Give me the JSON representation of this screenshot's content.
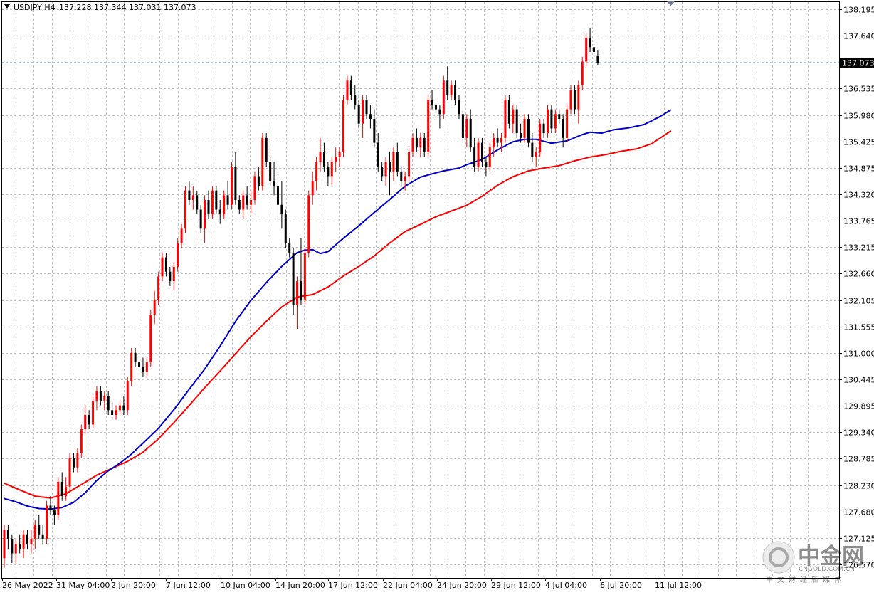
{
  "header": {
    "symbol_label": "USDJPY,H4",
    "ohlc_text": "137.228 137.344 137.031 137.073"
  },
  "colors": {
    "bull_candle": "#ff0000",
    "bear_candle": "#000000",
    "grid": "#c0c0c0",
    "ma_fast": "#0000cd",
    "ma_slow": "#ff0000",
    "price_tag_bg": "#000000",
    "price_line": "#a9b5c8"
  },
  "watermark": {
    "logo_text": "中金网",
    "domain_text": "CNGOLD.COM.CN",
    "tagline": "中文财经新媒体"
  },
  "chart_data": {
    "type": "candlestick",
    "symbol": "USDJPY",
    "timeframe": "H4",
    "current_price_label": "137.073",
    "y_ticks": [
      "138.195",
      "137.640",
      "137.085",
      "136.535",
      "135.980",
      "135.425",
      "134.875",
      "134.320",
      "133.765",
      "133.215",
      "132.660",
      "132.105",
      "131.555",
      "131.000",
      "130.445",
      "129.895",
      "129.340",
      "128.785",
      "128.230",
      "127.680",
      "127.125",
      "126.570"
    ],
    "ylim": [
      126.4,
      138.3
    ],
    "x_ticks": [
      "26 May 2022",
      "31 May 04:00",
      "2 Jun 20:00",
      "7 Jun 12:00",
      "10 Jun 04:00",
      "14 Jun 20:00",
      "17 Jun 12:00",
      "22 Jun 04:00",
      "24 Jun 20:00",
      "29 Jun 12:00",
      "4 Jul 04:00",
      "6 Jul 20:00",
      "11 Jul 12:00"
    ],
    "grid": true,
    "legend": "none",
    "ohlc": [
      [
        126.7,
        127.4,
        126.5,
        127.3
      ],
      [
        127.3,
        127.4,
        126.9,
        127.1
      ],
      [
        127.1,
        127.2,
        126.6,
        126.8
      ],
      [
        126.8,
        127.1,
        126.6,
        127.0
      ],
      [
        127.0,
        127.2,
        126.8,
        126.9
      ],
      [
        126.9,
        127.3,
        126.7,
        127.2
      ],
      [
        127.2,
        127.3,
        126.9,
        127.0
      ],
      [
        127.0,
        127.3,
        126.8,
        127.1
      ],
      [
        127.1,
        127.5,
        126.9,
        127.4
      ],
      [
        127.4,
        127.6,
        127.1,
        127.2
      ],
      [
        127.2,
        127.4,
        127.0,
        127.1
      ],
      [
        127.1,
        127.9,
        127.0,
        127.8
      ],
      [
        127.8,
        128.0,
        127.6,
        127.7
      ],
      [
        127.7,
        127.8,
        127.4,
        127.6
      ],
      [
        127.6,
        128.4,
        127.5,
        128.3
      ],
      [
        128.3,
        128.5,
        127.9,
        128.0
      ],
      [
        128.0,
        128.4,
        127.9,
        128.2
      ],
      [
        128.2,
        128.9,
        128.1,
        128.8
      ],
      [
        128.8,
        128.9,
        128.5,
        128.6
      ],
      [
        128.6,
        129.0,
        128.5,
        128.9
      ],
      [
        128.9,
        129.5,
        128.8,
        129.4
      ],
      [
        129.4,
        129.9,
        129.3,
        129.7
      ],
      [
        129.7,
        129.8,
        129.4,
        129.5
      ],
      [
        129.5,
        130.1,
        129.4,
        130.0
      ],
      [
        130.0,
        130.3,
        129.8,
        130.2
      ],
      [
        130.2,
        130.3,
        129.9,
        130.0
      ],
      [
        130.0,
        130.2,
        129.8,
        130.1
      ],
      [
        130.1,
        130.2,
        129.7,
        129.8
      ],
      [
        129.8,
        130.0,
        129.6,
        129.7
      ],
      [
        129.7,
        129.9,
        129.6,
        129.8
      ],
      [
        129.8,
        130.0,
        129.7,
        129.9
      ],
      [
        129.9,
        130.1,
        129.7,
        129.8
      ],
      [
        129.8,
        130.5,
        129.7,
        130.4
      ],
      [
        130.4,
        131.1,
        130.3,
        131.0
      ],
      [
        131.0,
        131.1,
        130.7,
        130.8
      ],
      [
        130.8,
        130.9,
        130.6,
        130.7
      ],
      [
        130.7,
        130.9,
        130.5,
        130.6
      ],
      [
        130.6,
        130.9,
        130.5,
        130.8
      ],
      [
        130.8,
        131.9,
        130.7,
        131.8
      ],
      [
        131.8,
        132.3,
        131.6,
        132.1
      ],
      [
        132.1,
        132.7,
        132.0,
        132.6
      ],
      [
        132.6,
        133.1,
        132.5,
        133.0
      ],
      [
        133.0,
        133.1,
        132.6,
        132.7
      ],
      [
        132.7,
        132.8,
        132.4,
        132.5
      ],
      [
        132.5,
        132.9,
        132.3,
        132.8
      ],
      [
        132.8,
        133.4,
        132.7,
        133.3
      ],
      [
        133.3,
        133.7,
        133.2,
        133.6
      ],
      [
        133.6,
        134.5,
        133.5,
        134.4
      ],
      [
        134.4,
        134.6,
        134.1,
        134.2
      ],
      [
        134.2,
        134.5,
        134.0,
        134.3
      ],
      [
        134.3,
        134.4,
        133.9,
        134.0
      ],
      [
        134.0,
        134.1,
        133.5,
        133.6
      ],
      [
        133.6,
        134.3,
        133.3,
        134.2
      ],
      [
        134.2,
        134.4,
        133.8,
        133.9
      ],
      [
        133.9,
        134.5,
        133.8,
        134.4
      ],
      [
        134.4,
        134.5,
        133.9,
        134.0
      ],
      [
        134.0,
        134.2,
        133.7,
        133.9
      ],
      [
        133.9,
        134.4,
        133.8,
        134.3
      ],
      [
        134.3,
        134.6,
        134.0,
        134.1
      ],
      [
        134.1,
        135.0,
        134.0,
        134.9
      ],
      [
        134.9,
        135.2,
        134.1,
        134.2
      ],
      [
        134.2,
        134.3,
        133.9,
        134.0
      ],
      [
        134.0,
        134.4,
        133.8,
        134.3
      ],
      [
        134.3,
        134.5,
        134.0,
        134.1
      ],
      [
        134.1,
        134.4,
        133.9,
        134.2
      ],
      [
        134.2,
        134.8,
        134.1,
        134.7
      ],
      [
        134.7,
        134.9,
        134.4,
        134.5
      ],
      [
        134.5,
        135.6,
        134.4,
        135.5
      ],
      [
        135.5,
        135.6,
        134.9,
        135.0
      ],
      [
        135.0,
        135.1,
        134.5,
        134.6
      ],
      [
        134.6,
        135.0,
        134.3,
        134.5
      ],
      [
        134.5,
        134.7,
        133.8,
        134.1
      ],
      [
        134.1,
        134.6,
        133.6,
        133.9
      ],
      [
        133.9,
        134.0,
        133.2,
        133.3
      ],
      [
        133.3,
        133.4,
        133.0,
        133.1
      ],
      [
        133.1,
        133.2,
        131.8,
        132.0
      ],
      [
        132.0,
        132.6,
        131.5,
        132.5
      ],
      [
        132.5,
        133.4,
        132.0,
        132.1
      ],
      [
        132.1,
        133.2,
        132.0,
        133.1
      ],
      [
        133.1,
        134.4,
        133.0,
        134.3
      ],
      [
        134.3,
        134.8,
        134.1,
        134.6
      ],
      [
        134.6,
        135.1,
        134.4,
        135.0
      ],
      [
        135.0,
        135.5,
        134.8,
        135.2
      ],
      [
        135.2,
        135.4,
        134.8,
        134.9
      ],
      [
        134.9,
        135.0,
        134.5,
        134.7
      ],
      [
        134.7,
        135.1,
        134.5,
        135.0
      ],
      [
        135.0,
        135.3,
        134.8,
        135.1
      ],
      [
        135.1,
        135.3,
        134.9,
        135.2
      ],
      [
        135.2,
        136.4,
        135.1,
        136.3
      ],
      [
        136.3,
        136.8,
        136.2,
        136.7
      ],
      [
        136.7,
        136.8,
        136.3,
        136.4
      ],
      [
        136.4,
        136.6,
        136.1,
        136.2
      ],
      [
        136.2,
        136.3,
        135.7,
        135.8
      ],
      [
        135.8,
        136.4,
        135.5,
        136.3
      ],
      [
        136.3,
        136.4,
        135.9,
        136.0
      ],
      [
        136.0,
        136.2,
        135.7,
        135.9
      ],
      [
        135.9,
        136.1,
        135.3,
        135.4
      ],
      [
        135.4,
        135.6,
        134.8,
        134.9
      ],
      [
        134.9,
        135.0,
        134.6,
        134.7
      ],
      [
        134.7,
        135.1,
        134.5,
        135.0
      ],
      [
        135.0,
        135.2,
        134.3,
        134.8
      ],
      [
        134.8,
        135.3,
        134.6,
        135.2
      ],
      [
        135.2,
        135.4,
        134.7,
        134.8
      ],
      [
        134.8,
        134.9,
        134.5,
        134.6
      ],
      [
        134.6,
        134.8,
        134.4,
        134.7
      ],
      [
        134.7,
        135.3,
        134.6,
        135.2
      ],
      [
        135.2,
        135.6,
        135.1,
        135.5
      ],
      [
        135.5,
        135.7,
        135.2,
        135.3
      ],
      [
        135.3,
        135.6,
        135.1,
        135.5
      ],
      [
        135.5,
        135.6,
        135.1,
        135.2
      ],
      [
        135.2,
        136.4,
        135.1,
        136.3
      ],
      [
        136.3,
        136.5,
        136.1,
        136.2
      ],
      [
        136.2,
        136.3,
        135.9,
        136.1
      ],
      [
        136.1,
        136.2,
        135.7,
        136.0
      ],
      [
        136.0,
        136.8,
        135.9,
        136.7
      ],
      [
        136.7,
        137.0,
        136.3,
        136.4
      ],
      [
        136.4,
        136.7,
        136.3,
        136.6
      ],
      [
        136.6,
        136.7,
        136.2,
        136.3
      ],
      [
        136.3,
        136.4,
        135.9,
        136.0
      ],
      [
        136.0,
        136.1,
        135.4,
        135.5
      ],
      [
        135.5,
        136.0,
        135.3,
        135.9
      ],
      [
        135.9,
        136.1,
        135.2,
        135.3
      ],
      [
        135.3,
        135.5,
        134.8,
        134.9
      ],
      [
        134.9,
        135.5,
        134.8,
        135.4
      ],
      [
        135.4,
        135.5,
        134.9,
        135.0
      ],
      [
        135.0,
        135.1,
        134.7,
        134.9
      ],
      [
        134.9,
        135.4,
        134.8,
        135.3
      ],
      [
        135.3,
        135.6,
        135.1,
        135.5
      ],
      [
        135.5,
        135.7,
        135.3,
        135.4
      ],
      [
        135.4,
        135.6,
        135.2,
        135.5
      ],
      [
        135.5,
        136.4,
        135.4,
        136.3
      ],
      [
        136.3,
        136.4,
        135.7,
        135.8
      ],
      [
        135.8,
        136.2,
        135.6,
        136.1
      ],
      [
        136.1,
        136.2,
        135.5,
        135.6
      ],
      [
        135.6,
        135.8,
        135.4,
        135.5
      ],
      [
        135.5,
        136.0,
        135.4,
        135.9
      ],
      [
        135.9,
        136.0,
        135.3,
        135.4
      ],
      [
        135.4,
        135.6,
        135.0,
        135.1
      ],
      [
        135.1,
        135.3,
        134.9,
        135.2
      ],
      [
        135.2,
        135.9,
        135.1,
        135.8
      ],
      [
        135.8,
        135.9,
        135.5,
        135.6
      ],
      [
        135.6,
        136.2,
        135.5,
        136.1
      ],
      [
        136.1,
        136.2,
        135.6,
        135.7
      ],
      [
        135.7,
        136.1,
        135.6,
        136.0
      ],
      [
        136.0,
        136.1,
        135.8,
        135.9
      ],
      [
        135.9,
        136.0,
        135.3,
        135.5
      ],
      [
        135.5,
        136.2,
        135.4,
        136.1
      ],
      [
        136.1,
        136.6,
        136.0,
        136.5
      ],
      [
        136.5,
        136.6,
        136.0,
        136.1
      ],
      [
        136.1,
        136.7,
        135.8,
        136.6
      ],
      [
        136.6,
        137.2,
        136.5,
        137.1
      ],
      [
        137.1,
        137.7,
        137.0,
        137.6
      ],
      [
        137.6,
        137.8,
        137.3,
        137.4
      ],
      [
        137.4,
        137.5,
        137.2,
        137.3
      ],
      [
        137.228,
        137.344,
        137.031,
        137.073
      ]
    ],
    "ma_blue": [
      [
        0,
        127.95
      ],
      [
        3,
        127.88
      ],
      [
        6,
        127.79
      ],
      [
        9,
        127.74
      ],
      [
        12,
        127.73
      ],
      [
        15,
        127.76
      ],
      [
        18,
        127.87
      ],
      [
        21,
        128.07
      ],
      [
        24,
        128.33
      ],
      [
        27,
        128.53
      ],
      [
        30,
        128.69
      ],
      [
        33,
        128.88
      ],
      [
        36,
        129.11
      ],
      [
        40,
        129.42
      ],
      [
        44,
        129.81
      ],
      [
        48,
        130.24
      ],
      [
        52,
        130.66
      ],
      [
        56,
        131.14
      ],
      [
        60,
        131.66
      ],
      [
        64,
        132.1
      ],
      [
        68,
        132.47
      ],
      [
        72,
        132.81
      ],
      [
        76,
        133.1
      ],
      [
        78,
        133.15
      ],
      [
        80,
        133.16
      ],
      [
        82,
        133.08
      ],
      [
        84,
        133.12
      ],
      [
        88,
        133.4
      ],
      [
        92,
        133.66
      ],
      [
        96,
        133.94
      ],
      [
        100,
        134.21
      ],
      [
        104,
        134.49
      ],
      [
        108,
        134.68
      ],
      [
        112,
        134.77
      ],
      [
        114,
        134.81
      ],
      [
        116,
        134.84
      ],
      [
        118,
        134.87
      ],
      [
        120,
        134.94
      ],
      [
        124,
        135.05
      ],
      [
        128,
        135.25
      ],
      [
        132,
        135.42
      ],
      [
        135,
        135.47
      ],
      [
        138,
        135.47
      ],
      [
        142,
        135.39
      ],
      [
        146,
        135.44
      ],
      [
        150,
        135.57
      ],
      [
        152,
        135.62
      ],
      [
        155,
        135.6
      ],
      [
        158,
        135.67
      ],
      [
        162,
        135.71
      ],
      [
        166,
        135.78
      ],
      [
        170,
        135.94
      ],
      [
        173,
        136.09
      ]
    ],
    "ma_red": [
      [
        0,
        128.27
      ],
      [
        4,
        128.13
      ],
      [
        8,
        128.0
      ],
      [
        12,
        127.96
      ],
      [
        16,
        128.05
      ],
      [
        20,
        128.24
      ],
      [
        24,
        128.44
      ],
      [
        28,
        128.58
      ],
      [
        32,
        128.73
      ],
      [
        36,
        128.92
      ],
      [
        40,
        129.2
      ],
      [
        44,
        129.54
      ],
      [
        48,
        129.9
      ],
      [
        52,
        130.27
      ],
      [
        56,
        130.62
      ],
      [
        60,
        130.98
      ],
      [
        64,
        131.34
      ],
      [
        68,
        131.66
      ],
      [
        72,
        131.96
      ],
      [
        76,
        132.17
      ],
      [
        80,
        132.22
      ],
      [
        84,
        132.38
      ],
      [
        88,
        132.61
      ],
      [
        92,
        132.81
      ],
      [
        96,
        133.03
      ],
      [
        100,
        133.3
      ],
      [
        104,
        133.54
      ],
      [
        108,
        133.69
      ],
      [
        112,
        133.85
      ],
      [
        116,
        133.97
      ],
      [
        120,
        134.09
      ],
      [
        124,
        134.28
      ],
      [
        128,
        134.51
      ],
      [
        132,
        134.69
      ],
      [
        136,
        134.81
      ],
      [
        140,
        134.87
      ],
      [
        144,
        134.92
      ],
      [
        148,
        135.02
      ],
      [
        152,
        135.1
      ],
      [
        156,
        135.15
      ],
      [
        160,
        135.22
      ],
      [
        164,
        135.27
      ],
      [
        168,
        135.38
      ],
      [
        173,
        135.65
      ]
    ]
  }
}
